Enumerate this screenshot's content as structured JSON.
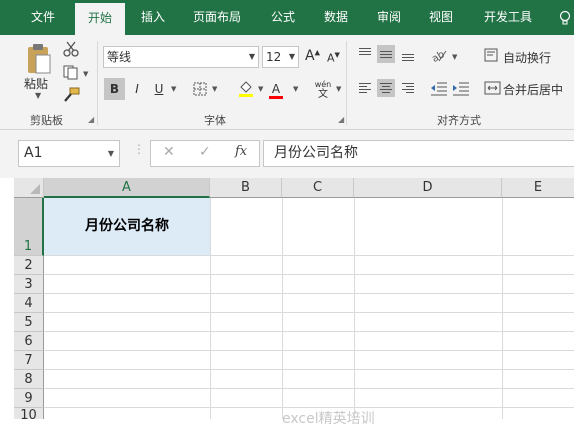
{
  "tabs": [
    {
      "label": "文件"
    },
    {
      "label": "开始"
    },
    {
      "label": "插入"
    },
    {
      "label": "页面布局"
    },
    {
      "label": "公式"
    },
    {
      "label": "数据"
    },
    {
      "label": "审阅"
    },
    {
      "label": "视图"
    },
    {
      "label": "开发工具"
    }
  ],
  "help_icon": "lightbulb-icon",
  "ribbon": {
    "clipboard": {
      "paste_label": "粘贴",
      "group_label": "剪贴板"
    },
    "font": {
      "font_name": "等线",
      "font_size": "12",
      "grow_label": "A",
      "shrink_label": "A",
      "bold_label": "B",
      "italic_label": "I",
      "underline_label": "U",
      "font_color_label": "A",
      "phonetic_label": "wén",
      "group_label": "字体"
    },
    "alignment": {
      "wrap_label": "自动换行",
      "merge_label": "合并后居中",
      "group_label": "对齐方式"
    }
  },
  "formula_bar": {
    "name_box": "A1",
    "cancel_icon": "✕",
    "confirm_icon": "✓",
    "fx_label": "fx",
    "content": "月份公司名称"
  },
  "grid": {
    "columns": [
      "A",
      "B",
      "C",
      "D",
      "E"
    ],
    "rows": [
      "1",
      "2",
      "3",
      "4",
      "5",
      "6",
      "7",
      "8",
      "9",
      "10"
    ],
    "cell_a1": "月份公司名称",
    "selection_color": "#217346"
  },
  "watermark": "excel精英培训",
  "colors": {
    "accent": "#217346",
    "ribbon_bg": "#f3f3f3",
    "cell_fill": "#ddebf7"
  }
}
